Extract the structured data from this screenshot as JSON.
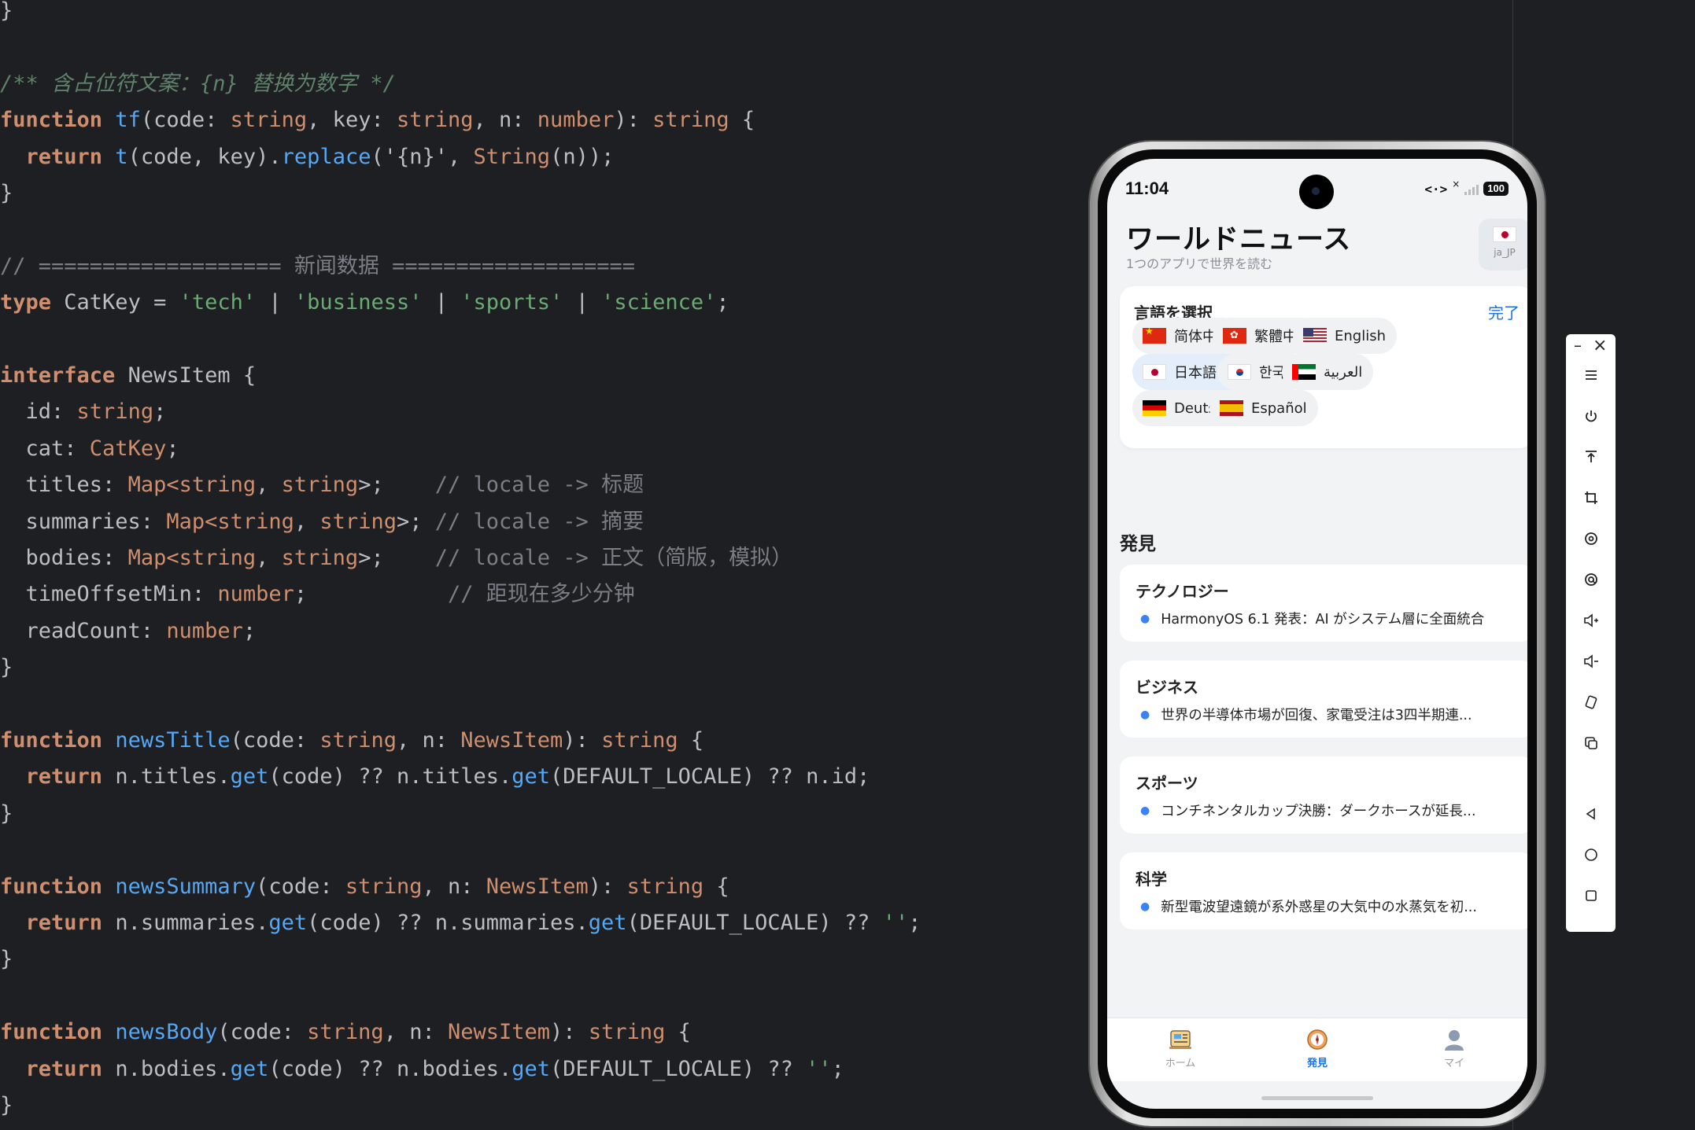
{
  "editor": {
    "lines": [
      [
        "}"
      ],
      [
        ""
      ],
      [
        "/** 含占位符文案：{n} 替换为数字 */"
      ],
      [
        "function",
        " ",
        "tf",
        "(code: ",
        "string",
        ", key: ",
        "string",
        ", n: ",
        "number",
        "): ",
        "string",
        " {"
      ],
      [
        "  ",
        "return",
        " ",
        "t",
        "(code, key).",
        "replace",
        "('{n}', ",
        "String",
        "(n));"
      ],
      [
        "}"
      ],
      [
        ""
      ],
      [
        "// =================== 新闻数据 ==================="
      ],
      [
        "type",
        " CatKey = ",
        "'tech'",
        " | ",
        "'business'",
        " | ",
        "'sports'",
        " | ",
        "'science'",
        ";"
      ],
      [
        ""
      ],
      [
        "interface",
        " NewsItem {"
      ],
      [
        "  id: ",
        "string",
        ";"
      ],
      [
        "  cat: ",
        "CatKey",
        ";"
      ],
      [
        "  titles: ",
        "Map<",
        "string",
        ", ",
        "string",
        ">;    ",
        "// locale -> 标题"
      ],
      [
        "  summaries: ",
        "Map<",
        "string",
        ", ",
        "string",
        ">; ",
        "// locale -> 摘要"
      ],
      [
        "  bodies: ",
        "Map<",
        "string",
        ", ",
        "string",
        ">;    ",
        "// locale -> 正文（简版，模拟）"
      ],
      [
        "  timeOffsetMin: ",
        "number",
        ";           ",
        "// 距现在多少分钟"
      ],
      [
        "  readCount: ",
        "number",
        ";"
      ],
      [
        "}"
      ],
      [
        ""
      ],
      [
        "function",
        " ",
        "newsTitle",
        "(code: ",
        "string",
        ", n: ",
        "NewsItem",
        "): ",
        "string",
        " {"
      ],
      [
        "  ",
        "return",
        " n.titles.",
        "get",
        "(code) ?? n.titles.",
        "get",
        "(DEFAULT_LOCALE) ?? n.id;"
      ],
      [
        "}"
      ],
      [
        ""
      ],
      [
        "function",
        " ",
        "newsSummary",
        "(code: ",
        "string",
        ", n: ",
        "NewsItem",
        "): ",
        "string",
        " {"
      ],
      [
        "  ",
        "return",
        " n.summaries.",
        "get",
        "(code) ?? n.summaries.",
        "get",
        "(DEFAULT_LOCALE) ?? ",
        "''",
        ";"
      ],
      [
        "}"
      ],
      [
        ""
      ],
      [
        "function",
        " ",
        "newsBody",
        "(code: ",
        "string",
        ", n: ",
        "NewsItem",
        "): ",
        "string",
        " {"
      ],
      [
        "  ",
        "return",
        " n.bodies.",
        "get",
        "(code) ?? n.bodies.",
        "get",
        "(DEFAULT_LOCALE) ?? ",
        "''",
        ";"
      ],
      [
        "}"
      ]
    ]
  },
  "phone": {
    "status": {
      "time": "11:04",
      "code_icon": "<·>",
      "x": "×",
      "battery": "100"
    },
    "app": {
      "title": "ワールドニュース",
      "subtitle": "1つのアプリで世界を読む",
      "locale_code": "ja_JP"
    },
    "language_panel": {
      "title": "言語を選択",
      "done": "完了",
      "languages": [
        {
          "label": "简体中文",
          "flag": "cn"
        },
        {
          "label": "繁體中文",
          "flag": "hk"
        },
        {
          "label": "English",
          "flag": "us"
        },
        {
          "label": "日本語",
          "flag": "jp",
          "selected": true,
          "check": "✓"
        },
        {
          "label": "한국어",
          "flag": "kr"
        },
        {
          "label": "العربية",
          "flag": "ae"
        },
        {
          "label": "Deutsch",
          "flag": "de"
        },
        {
          "label": "Español",
          "flag": "es"
        }
      ]
    },
    "discover": {
      "title": "発見",
      "cards": [
        {
          "category": "テクノロジー",
          "headline": "HarmonyOS 6.1 発表：AI がシステム層に全面統合"
        },
        {
          "category": "ビジネス",
          "headline": "世界の半導体市場が回復、家電受注は3四半期連..."
        },
        {
          "category": "スポーツ",
          "headline": "コンチネンタルカップ決勝：ダークホースが延長..."
        },
        {
          "category": "科学",
          "headline": "新型電波望遠鏡が系外惑星の大気中の水蒸気を初..."
        }
      ]
    },
    "tabs": [
      {
        "label": "ホーム",
        "icon": "newspaper-icon",
        "active": false
      },
      {
        "label": "発見",
        "icon": "compass-icon",
        "active": true
      },
      {
        "label": "マイ",
        "icon": "person-icon",
        "active": false
      }
    ]
  },
  "emulator_toolbar": {
    "buttons": [
      "menu-icon",
      "power-icon",
      "top-icon",
      "crop-icon",
      "rotate-icon",
      "location-icon",
      "volume-up-icon",
      "volume-down-icon",
      "shake-icon",
      "screenshot-icon",
      "back-icon",
      "home-icon",
      "recent-icon"
    ]
  }
}
